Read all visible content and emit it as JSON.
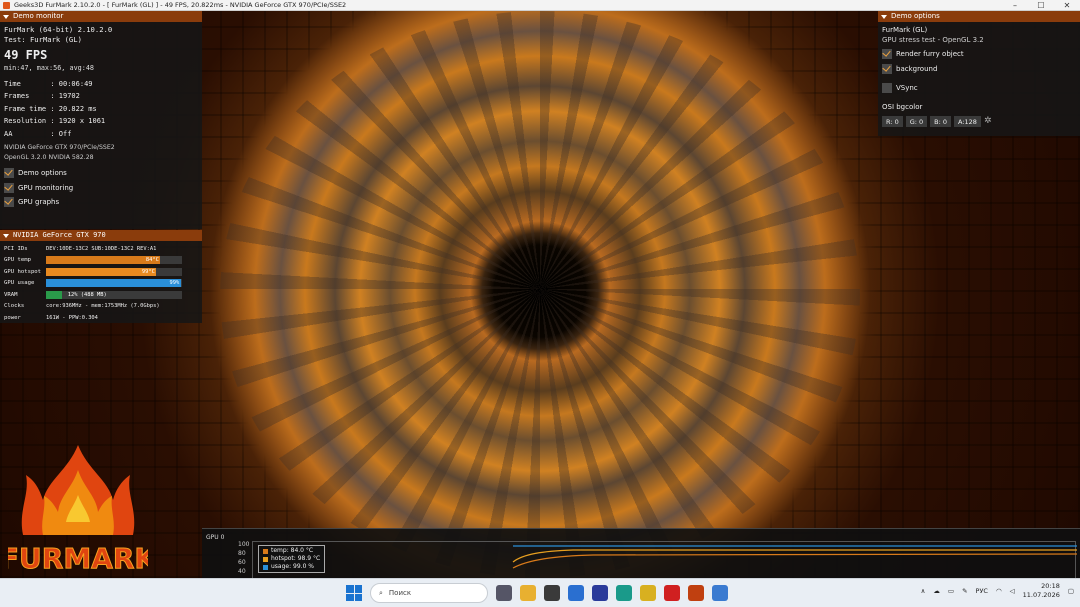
{
  "window": {
    "title": "Geeks3D FurMark 2.10.2.0 - [ FurMark (GL) ] - 49 FPS, 20.822ms - NVIDIA GeForce GTX 970/PCIe/SSE2",
    "minimize": "–",
    "maximize": "☐",
    "close": "✕"
  },
  "monitor": {
    "header": "Demo monitor",
    "app": "FurMark (64-bit) 2.10.2.0",
    "test": "Test: FurMark (GL)",
    "fps": "49 FPS",
    "minmax": "min:47, max:56, avg:48",
    "stats": [
      "Time       : 00:06:49",
      "Frames     : 19702",
      "Frame time : 20.822 ms",
      "Resolution : 1920 x 1061",
      "AA         : Off"
    ],
    "gpu_name": "NVIDIA GeForce GTX 970/PCIe/SSE2",
    "gl_version": "OpenGL 3.2.0 NVIDIA 582.28",
    "checks": [
      {
        "label": "Demo options",
        "on": true
      },
      {
        "label": "GPU monitoring",
        "on": true
      },
      {
        "label": "GPU graphs",
        "on": true
      }
    ]
  },
  "gpu": {
    "header": "NVIDIA GeForce GTX 970",
    "pci_label": "PCI IDs",
    "pci": "DEV:10DE-13C2 SUB:10DE-13C2 REV:A1",
    "bars": [
      {
        "label": "GPU temp",
        "value": "84°C",
        "fill": 0.84,
        "color": "#d87a1a"
      },
      {
        "label": "GPU hotspot",
        "value": "99°C",
        "fill": 0.81,
        "color": "#e88a20"
      },
      {
        "label": "GPU usage",
        "value": "99%",
        "fill": 0.99,
        "color": "#2a8fd8"
      },
      {
        "label": "VRAM",
        "value": "12% (488 MB)",
        "fill": 0.12,
        "color": "#2a9a4a"
      }
    ],
    "clocks_label": "Clocks",
    "clocks": "core:936MHz - mem:1753MHz (7.0Gbps)",
    "power_label": "power",
    "power": "161W - PPW:0.304"
  },
  "options": {
    "header": "Demo options",
    "line1": "FurMark (GL)",
    "line2": "GPU stress test - OpenGL 3.2",
    "checks": [
      {
        "label": "Render furry object",
        "on": true
      },
      {
        "label": "background",
        "on": true
      }
    ],
    "vsync": "VSync",
    "osi_label": "OSI bgcolor",
    "osi": [
      "R: 0",
      "G: 0",
      "B: 0",
      "A:128"
    ]
  },
  "graph": {
    "title": "GPU 0",
    "yticks": [
      "100",
      "80",
      "60",
      "40"
    ],
    "legend": [
      {
        "label": "temp: 84.0 °C",
        "color": "#d87a1a"
      },
      {
        "label": "hotspot: 98.9 °C",
        "color": "#e8a020"
      },
      {
        "label": "usage: 99.0 %",
        "color": "#2a8fd8"
      }
    ]
  },
  "logo": {
    "text": "FURMARK"
  },
  "taskbar": {
    "search": "Поиск",
    "lang": "РУС",
    "time": "20:18",
    "date": "11.07.2026",
    "apps": [
      {
        "name": "taskview-icon",
        "color": "#556"
      },
      {
        "name": "files-icon",
        "color": "#e8b030"
      },
      {
        "name": "store-icon",
        "color": "#3a3a3a"
      },
      {
        "name": "network-icon",
        "color": "#2a6fd0"
      },
      {
        "name": "teams-icon",
        "color": "#2a3a9a"
      },
      {
        "name": "edge-icon",
        "color": "#1a9a8a"
      },
      {
        "name": "chrome-icon",
        "color": "#d8b020"
      },
      {
        "name": "opera-icon",
        "color": "#d02020"
      },
      {
        "name": "furmark-icon",
        "color": "#c04010"
      },
      {
        "name": "app-icon",
        "color": "#3a7ad0"
      }
    ]
  }
}
